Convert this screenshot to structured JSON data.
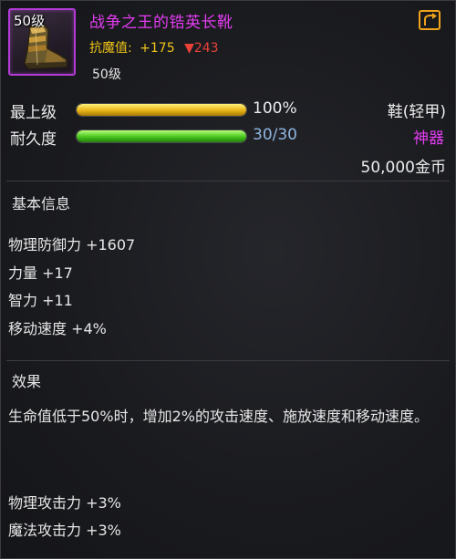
{
  "item": {
    "icon_level": "50级",
    "icon_name": "boot-icon",
    "name": "战争之王的锆英长靴",
    "resist_label": "抗魔值:",
    "resist_plus": "+175",
    "resist_minus": "▼243",
    "level_requirement": "50级",
    "share_icon": "share-icon"
  },
  "bars": {
    "upgrade_label": "最上级",
    "upgrade_value": "100%",
    "upgrade_fraction": 1.0,
    "durability_label": "耐久度",
    "durability_value": "30/30",
    "durability_fraction": 1.0
  },
  "meta": {
    "type": "鞋(轻甲)",
    "grade": "神器",
    "price": "50,000金币"
  },
  "basic_info": {
    "title": "基本信息",
    "stats": [
      "物理防御力 +1607",
      "力量 +17",
      "智力 +11",
      "移动速度 +4%"
    ]
  },
  "effects": {
    "title": "效果",
    "description": "生命值低于50%时，增加2%的攻击速度、施放速度和移动速度。",
    "stats": [
      "物理攻击力 +3%",
      "魔法攻击力 +3%"
    ]
  },
  "colors": {
    "name": "#e23cf0",
    "grade": "#e23cf0",
    "resist_label": "#f0c419",
    "resist_minus": "#e8413a",
    "durability_value": "#8fb6df",
    "upgrade_bar": "#e8b316",
    "durability_bar": "#47c41e",
    "icon_border": "#b23bd6",
    "share_button": "#f0a21a"
  }
}
